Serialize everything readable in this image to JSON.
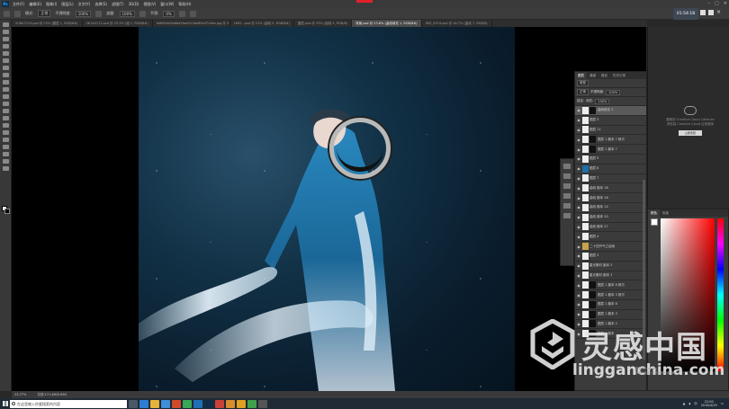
{
  "menubar": {
    "logo": "Ps",
    "items": [
      "文件(F)",
      "编辑(E)",
      "图像(I)",
      "图层(L)",
      "文字(Y)",
      "选择(S)",
      "滤镜(T)",
      "3D(D)",
      "视图(V)",
      "窗口(W)",
      "帮助(H)"
    ]
  },
  "options": {
    "mode_label": "模式:",
    "mode_value": "正常",
    "opacity_label": "不透明度:",
    "opacity_value": "100%",
    "flow_label": "流量:",
    "flow_value": "100%",
    "smooth_label": "平滑:",
    "smooth_value": "0%"
  },
  "tabs": [
    {
      "label": "0U8A7219.psd @ 25% (图层 1, RGB/8#)"
    },
    {
      "label": "0K1A0172.psd @ 33.3% (组 1, RGB/8#)"
    },
    {
      "label": "fe8f85dd9a8bd5faa2fc3be69a37c9bb.jpg @ 33.3% (图层 1, RGB/8)"
    },
    {
      "label": "1600...psd @ 21% (曲线 3, RGB/8#)"
    },
    {
      "label": "图层.psd @ 33% (曲线 5, RGB/8)"
    },
    {
      "label": "背景.psd @ 23.8% (曲线填充 1, RGB/8#)",
      "active": true
    },
    {
      "label": "IMG_5919.psd @ 16.7% (曲线 7, RGB/8)"
    }
  ],
  "timer": "01:54:18",
  "layers_panel": {
    "tabs": [
      "图层",
      "通道",
      "路径",
      "历史记录"
    ],
    "kind_label": "类型",
    "blend_mode": "正常",
    "opacity_label": "不透明度:",
    "opacity_value": "100%",
    "lock_label": "锁定:",
    "fill_label": "填充:",
    "fill_value": "100%",
    "rows": [
      {
        "name": "曲线填充 1",
        "thumb": "white",
        "mask": true,
        "selected": true
      },
      {
        "name": "图层 5",
        "thumb": "white",
        "mask": false
      },
      {
        "name": "图层 11",
        "thumb": "white",
        "mask": false
      },
      {
        "name": "图层 1 副本 7 拷贝",
        "thumb": "white",
        "mask": true
      },
      {
        "name": "图层 1 副本 7",
        "thumb": "white",
        "mask": true
      },
      {
        "name": "图层 9",
        "thumb": "white",
        "mask": false
      },
      {
        "name": "图层 8",
        "thumb": "blue",
        "mask": false
      },
      {
        "name": "图层 7",
        "thumb": "white",
        "mask": false
      },
      {
        "name": "曲线 副本 18",
        "thumb": "white",
        "mask": false
      },
      {
        "name": "曲线 副本 16",
        "thumb": "white",
        "mask": false
      },
      {
        "name": "曲线 副本 14",
        "thumb": "white",
        "mask": false
      },
      {
        "name": "曲线 副本 20",
        "thumb": "white",
        "mask": false
      },
      {
        "name": "曲线 副本 27",
        "thumb": "white",
        "mask": false
      },
      {
        "name": "图层 4",
        "thumb": "white",
        "mask": false
      },
      {
        "name": "二十四节气之谷雨",
        "thumb": "folder",
        "mask": false
      },
      {
        "name": "图层 3",
        "thumb": "white",
        "mask": false
      },
      {
        "name": "星光素材 副本 5",
        "thumb": "white",
        "mask": false
      },
      {
        "name": "星光素材 副本 3",
        "thumb": "white",
        "mask": false
      },
      {
        "name": "图层 1 副本 8 拷贝",
        "thumb": "white",
        "mask": true
      },
      {
        "name": "图层 1 副本 3 拷贝",
        "thumb": "white",
        "mask": true
      },
      {
        "name": "图层 1 副本 8",
        "thumb": "white",
        "mask": true
      },
      {
        "name": "图层 1 副本 3",
        "thumb": "white",
        "mask": true
      },
      {
        "name": "图层 1 副本 2",
        "thumb": "white",
        "mask": true
      },
      {
        "name": "图层 1 副本",
        "thumb": "white",
        "mask": true
      }
    ]
  },
  "creative_cloud": {
    "line1": "要使用 Creative Cloud Libraries",
    "line2": "请安装 Creative Cloud 应用程序",
    "button": "立即安装"
  },
  "color_panel": {
    "tabs": [
      "颜色",
      "色板"
    ]
  },
  "watermark": {
    "cn": "灵感中国",
    "en": "lingganchina.com"
  },
  "activate_windows": {
    "line1": "激活 Windows",
    "line2": "转到\"设置\"以激活 Windows。"
  },
  "statusbar": {
    "zoom": "23.77%",
    "doc": "文档:171.4M/5.65G"
  },
  "taskbar": {
    "search_placeholder": "在这里输入你要搜索的内容",
    "clock_time": "22:00",
    "clock_date": "2018/4/29",
    "ime": "中"
  },
  "colors": {
    "accent": "#31a8ff",
    "rec": "#e0202a"
  }
}
